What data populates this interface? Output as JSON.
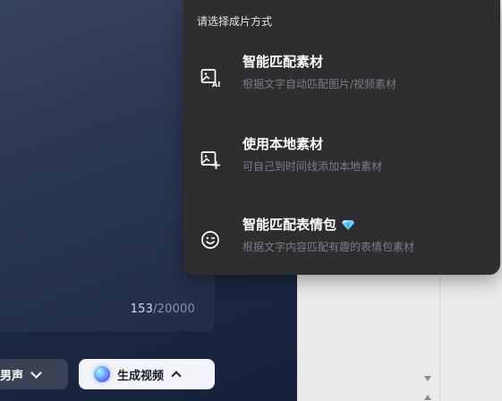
{
  "editor": {
    "char_count": "153",
    "char_max": "/20000",
    "voice_label": "男声",
    "generate_label": "生成视频"
  },
  "popover": {
    "title": "请选择成片方式",
    "options": [
      {
        "title": "智能匹配素材",
        "desc": "根据文字自动匹配图片/视频素材",
        "icon": "ai-image-icon"
      },
      {
        "title": "使用本地素材",
        "desc": "可自己到时间线添加本地素材",
        "icon": "add-image-icon"
      },
      {
        "title": "智能匹配表情包",
        "desc": "根据文字内容匹配有趣的表情包素材",
        "icon": "wink-emoji-icon",
        "badge": "vip-diamond-icon"
      }
    ]
  },
  "colors": {
    "popover_bg": "#2e2e31",
    "editor_bg": "#1f2c47",
    "desc_text": "#7c7c82",
    "diamond": "#6fd3ff"
  }
}
